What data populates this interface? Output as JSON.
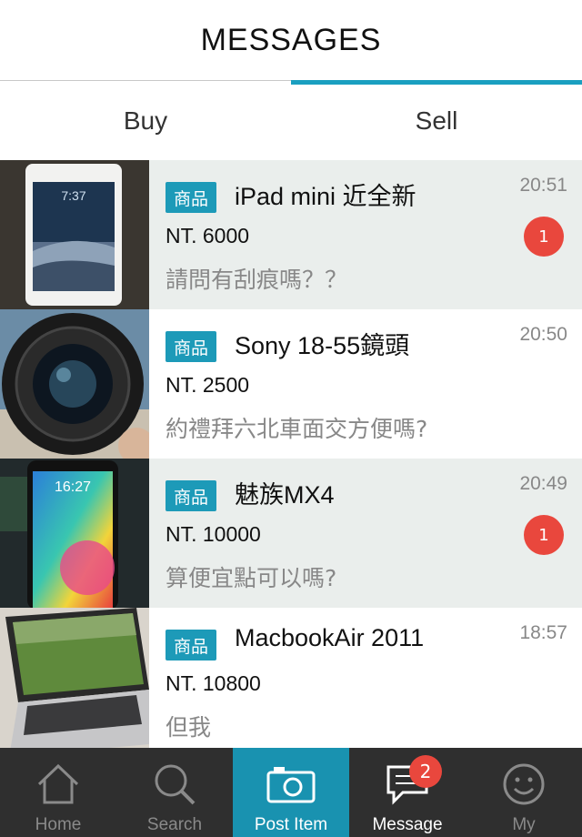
{
  "header": {
    "title": "MESSAGES"
  },
  "tabs": [
    {
      "label": "Buy",
      "active": false
    },
    {
      "label": "Sell",
      "active": true
    }
  ],
  "conversations": [
    {
      "tag": "商品",
      "title": "iPad mini 近全新",
      "price": "NT. 6000",
      "message": "請問有刮痕嗎？？",
      "time": "20:51",
      "unread": "1"
    },
    {
      "tag": "商品",
      "title": "Sony 18-55鏡頭",
      "price": "NT. 2500",
      "message": "約禮拜六北車面交方便嗎?",
      "time": "20:50",
      "unread": ""
    },
    {
      "tag": "商品",
      "title": "魅族MX4",
      "price": "NT. 10000",
      "message": "算便宜點可以嗎?",
      "time": "20:49",
      "unread": "1"
    },
    {
      "tag": "商品",
      "title": "MacbookAir 2011",
      "price": "NT. 10800",
      "message": "但我",
      "time": "18:57",
      "unread": ""
    }
  ],
  "tabbar": {
    "items": [
      {
        "label": "Home",
        "icon": "home-icon"
      },
      {
        "label": "Search",
        "icon": "search-icon"
      },
      {
        "label": "Post Item",
        "icon": "camera-icon"
      },
      {
        "label": "Message",
        "icon": "message-icon",
        "badge": "2"
      },
      {
        "label": "My",
        "icon": "smiley-icon"
      }
    ]
  },
  "colors": {
    "accent": "#1a9fc0",
    "badge": "#e9473d",
    "tabbar": "#2f2f2f"
  }
}
